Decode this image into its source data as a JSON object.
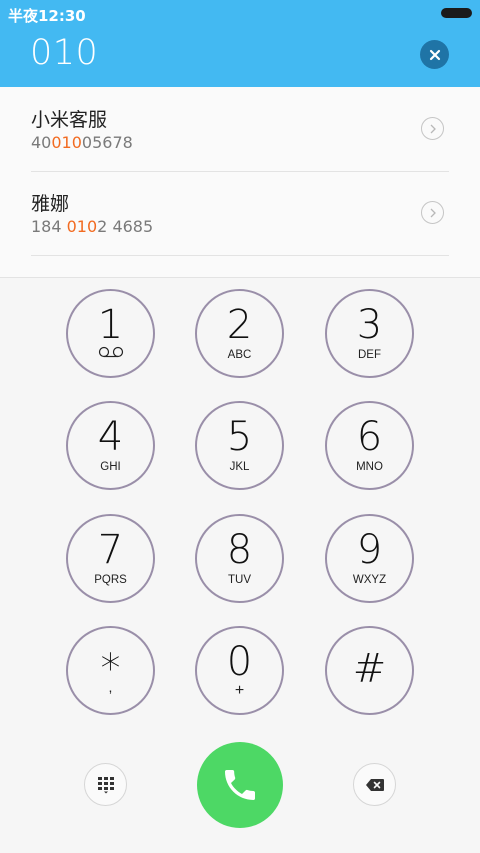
{
  "status_bar": {
    "time": "半夜12:30",
    "battery_icon": "battery-icon"
  },
  "dialer": {
    "number": "010",
    "clear_icon": "clear-icon"
  },
  "contacts": [
    {
      "name": "小米客服",
      "number_prefix": "40",
      "number_match": "010",
      "number_suffix": "05678",
      "detail_icon": "chevron-right-icon"
    },
    {
      "name": "雅娜",
      "number_prefix": "184 ",
      "number_match": "010",
      "number_suffix": "2 4685",
      "detail_icon": "chevron-right-icon"
    }
  ],
  "keypad": [
    {
      "digit": "1",
      "letters": "",
      "icon": "voicemail-icon"
    },
    {
      "digit": "2",
      "letters": "ABC"
    },
    {
      "digit": "3",
      "letters": "DEF"
    },
    {
      "digit": "4",
      "letters": "GHI"
    },
    {
      "digit": "5",
      "letters": "JKL"
    },
    {
      "digit": "6",
      "letters": "MNO"
    },
    {
      "digit": "7",
      "letters": "PQRS"
    },
    {
      "digit": "8",
      "letters": "TUV"
    },
    {
      "digit": "9",
      "letters": "WXYZ"
    },
    {
      "digit": "*",
      "letters": ","
    },
    {
      "digit": "0",
      "letters": "+"
    },
    {
      "digit": "#",
      "letters": ""
    }
  ],
  "bottom_bar": {
    "keypad_toggle_icon": "dialpad-icon",
    "call_icon": "phone-icon",
    "delete_icon": "backspace-icon"
  },
  "colors": {
    "header": "#43b9f2",
    "highlight": "#f26b21",
    "call": "#4dd865",
    "key_ring": "#9a8fa9"
  }
}
